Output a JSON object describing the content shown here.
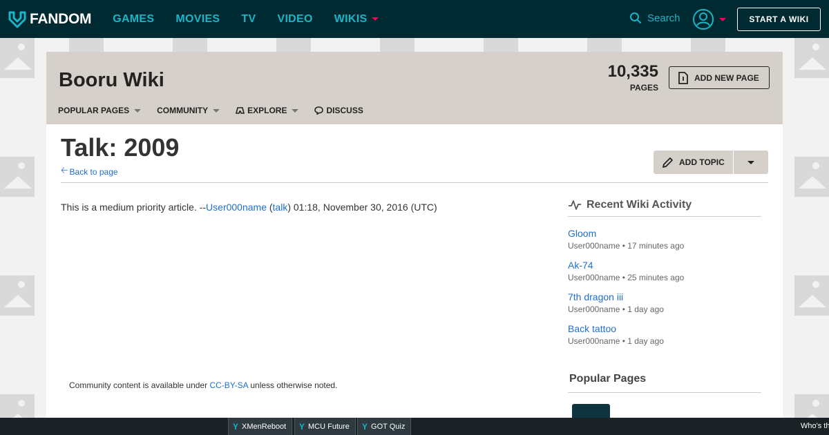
{
  "top_nav": {
    "logo_text": "FANDOM",
    "links": [
      "GAMES",
      "MOVIES",
      "TV",
      "VIDEO",
      "WIKIS"
    ],
    "search_label": "Search",
    "start_wiki_label": "START A WIKI"
  },
  "wiki_header": {
    "title": "Booru Wiki",
    "page_count": "10,335",
    "page_count_label": "PAGES",
    "add_page_label": "ADD NEW PAGE",
    "nav": [
      "POPULAR PAGES",
      "COMMUNITY",
      "EXPLORE",
      "DISCUSS"
    ]
  },
  "page": {
    "title": "Talk: 2009",
    "back_link": "Back to page",
    "add_topic_label": "ADD TOPIC",
    "body_prefix": "This is a medium priority article. --",
    "body_user": "User000name",
    "body_paren_open": " (",
    "body_talk": "talk",
    "body_suffix": ") 01:18, November 30, 2016 (UTC)",
    "license_prefix": "Community content is available under ",
    "license_link": "CC-BY-SA",
    "license_suffix": " unless otherwise noted."
  },
  "right_rail": {
    "recent_title": "Recent Wiki Activity",
    "activity": [
      {
        "title": "Gloom",
        "meta": "User000name • 17 minutes ago"
      },
      {
        "title": "Ak-74",
        "meta": "User000name • 25 minutes ago"
      },
      {
        "title": "7th dragon iii",
        "meta": "User000name • 1 day ago"
      },
      {
        "title": "Back tattoo",
        "meta": "User000name • 1 day ago"
      }
    ],
    "popular_title": "Popular Pages"
  },
  "bottom_bar": {
    "items": [
      "XMenReboot",
      "MCU Future",
      "GOT Quiz"
    ],
    "right_text": "Who's th"
  },
  "colors": {
    "nav_bg": "#002a32",
    "nav_link": "#19b5c8",
    "accent": "#fa005a",
    "header_bg": "#d5d1ca",
    "link": "#1f6fcf"
  }
}
